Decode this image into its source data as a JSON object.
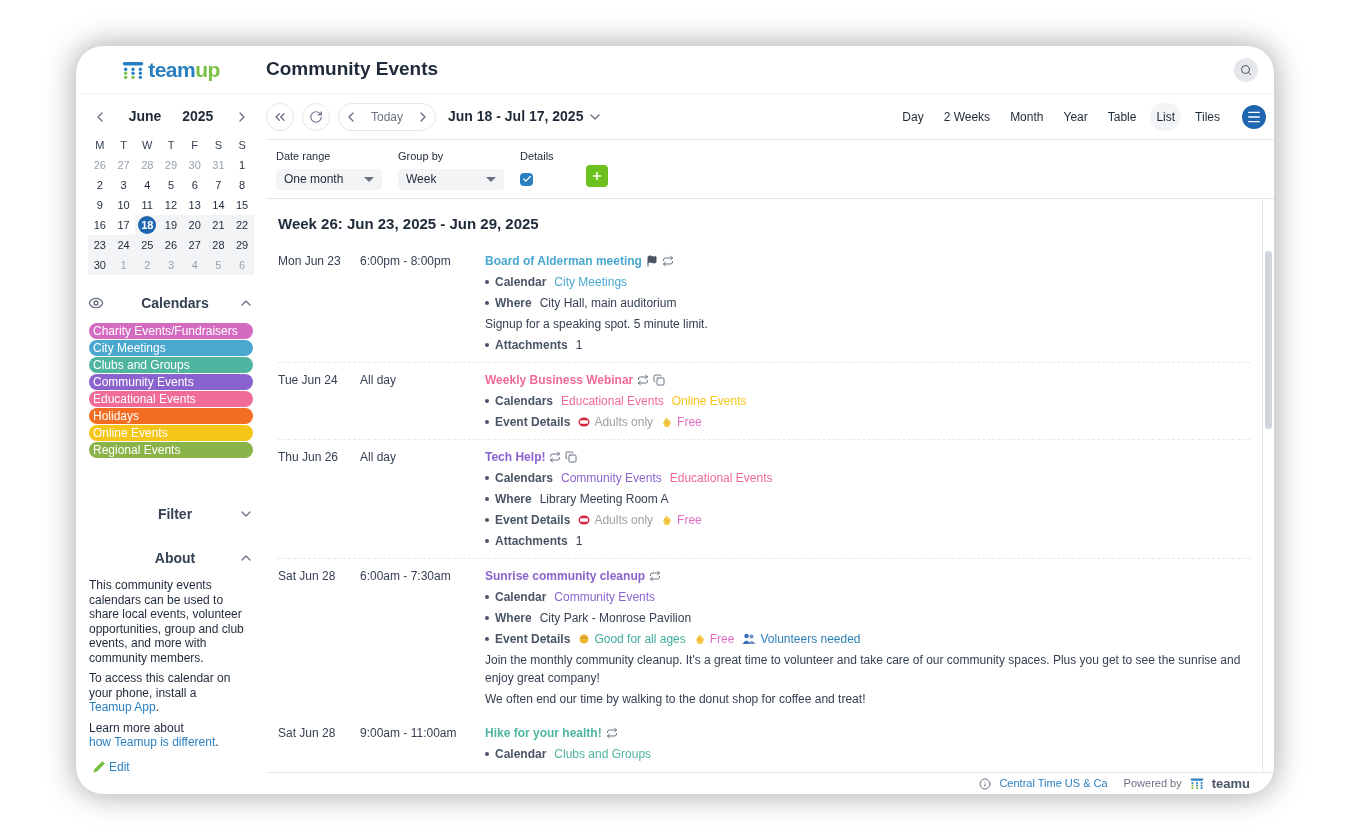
{
  "logo": {
    "part_1": "team",
    "part_2": "up"
  },
  "title": "Community Events",
  "mini_calendar": {
    "month": "June",
    "year": "2025",
    "weekdays": [
      "M",
      "T",
      "W",
      "T",
      "F",
      "S",
      "S"
    ],
    "weeks": [
      [
        {
          "d": "26",
          "muted": true,
          "in_range": false,
          "selected": false
        },
        {
          "d": "27",
          "muted": true,
          "in_range": false,
          "selected": false
        },
        {
          "d": "28",
          "muted": true,
          "in_range": false,
          "selected": false
        },
        {
          "d": "29",
          "muted": true,
          "in_range": false,
          "selected": false
        },
        {
          "d": "30",
          "muted": true,
          "in_range": false,
          "selected": false
        },
        {
          "d": "31",
          "muted": true,
          "in_range": false,
          "selected": false
        },
        {
          "d": "1",
          "muted": false,
          "in_range": false,
          "selected": false
        }
      ],
      [
        {
          "d": "2",
          "muted": false,
          "in_range": false,
          "selected": false
        },
        {
          "d": "3",
          "muted": false,
          "in_range": false,
          "selected": false
        },
        {
          "d": "4",
          "muted": false,
          "in_range": false,
          "selected": false
        },
        {
          "d": "5",
          "muted": false,
          "in_range": false,
          "selected": false
        },
        {
          "d": "6",
          "muted": false,
          "in_range": false,
          "selected": false
        },
        {
          "d": "7",
          "muted": false,
          "in_range": false,
          "selected": false
        },
        {
          "d": "8",
          "muted": false,
          "in_range": false,
          "selected": false
        }
      ],
      [
        {
          "d": "9",
          "muted": false,
          "in_range": false,
          "selected": false
        },
        {
          "d": "10",
          "muted": false,
          "in_range": false,
          "selected": false
        },
        {
          "d": "11",
          "muted": false,
          "in_range": false,
          "selected": false
        },
        {
          "d": "12",
          "muted": false,
          "in_range": false,
          "selected": false
        },
        {
          "d": "13",
          "muted": false,
          "in_range": false,
          "selected": false
        },
        {
          "d": "14",
          "muted": false,
          "in_range": false,
          "selected": false
        },
        {
          "d": "15",
          "muted": false,
          "in_range": false,
          "selected": false
        }
      ],
      [
        {
          "d": "16",
          "muted": false,
          "in_range": false,
          "selected": false
        },
        {
          "d": "17",
          "muted": false,
          "in_range": false,
          "selected": false
        },
        {
          "d": "18",
          "muted": false,
          "in_range": true,
          "selected": true
        },
        {
          "d": "19",
          "muted": false,
          "in_range": true,
          "selected": false
        },
        {
          "d": "20",
          "muted": false,
          "in_range": true,
          "selected": false
        },
        {
          "d": "21",
          "muted": false,
          "in_range": true,
          "selected": false
        },
        {
          "d": "22",
          "muted": false,
          "in_range": true,
          "selected": false
        }
      ],
      [
        {
          "d": "23",
          "muted": false,
          "in_range": true,
          "selected": false
        },
        {
          "d": "24",
          "muted": false,
          "in_range": true,
          "selected": false
        },
        {
          "d": "25",
          "muted": false,
          "in_range": true,
          "selected": false
        },
        {
          "d": "26",
          "muted": false,
          "in_range": true,
          "selected": false
        },
        {
          "d": "27",
          "muted": false,
          "in_range": true,
          "selected": false
        },
        {
          "d": "28",
          "muted": false,
          "in_range": true,
          "selected": false
        },
        {
          "d": "29",
          "muted": false,
          "in_range": true,
          "selected": false
        }
      ],
      [
        {
          "d": "30",
          "muted": false,
          "in_range": true,
          "selected": false
        },
        {
          "d": "1",
          "muted": true,
          "in_range": true,
          "selected": false
        },
        {
          "d": "2",
          "muted": true,
          "in_range": true,
          "selected": false
        },
        {
          "d": "3",
          "muted": true,
          "in_range": true,
          "selected": false
        },
        {
          "d": "4",
          "muted": true,
          "in_range": true,
          "selected": false
        },
        {
          "d": "5",
          "muted": true,
          "in_range": true,
          "selected": false
        },
        {
          "d": "6",
          "muted": true,
          "in_range": true,
          "selected": false
        }
      ]
    ]
  },
  "calendars": {
    "heading": "Calendars",
    "expanded": true,
    "items": [
      {
        "label": "Charity Events/Fundraisers",
        "color": "#d46bc1"
      },
      {
        "label": "City Meetings",
        "color": "#4aa8d0"
      },
      {
        "label": "Clubs and Groups",
        "color": "#4fb5a0"
      },
      {
        "label": "Community Events",
        "color": "#8b63cf"
      },
      {
        "label": "Educational Events",
        "color": "#f06a9a"
      },
      {
        "label": "Holidays",
        "color": "#f26d22"
      },
      {
        "label": "Online Events",
        "color": "#f5c518"
      },
      {
        "label": "Regional Events",
        "color": "#8ab34a"
      }
    ]
  },
  "filter": {
    "heading": "Filter",
    "expanded": false
  },
  "about": {
    "heading": "About",
    "expanded": true,
    "paragraph_1": "This community events calendars can be used to share local events, volunteer opportunities, group and club events, and more with community members.",
    "paragraph_2_text": "To access this calendar on your phone, install a",
    "paragraph_2_link": "Teamup App",
    "paragraph_2_end": ".",
    "paragraph_3_text": "Learn more about",
    "paragraph_3_link": "how Teamup is different",
    "paragraph_3_end": ".",
    "edit": "Edit"
  },
  "toolbar": {
    "today": "Today",
    "range": "Jun 18 - Jul 17, 2025",
    "views": [
      {
        "label": "Day",
        "selected": false
      },
      {
        "label": "2 Weeks",
        "selected": false
      },
      {
        "label": "Month",
        "selected": false
      },
      {
        "label": "Year",
        "selected": false
      },
      {
        "label": "Table",
        "selected": false
      },
      {
        "label": "List",
        "selected": true
      },
      {
        "label": "Tiles",
        "selected": false
      }
    ]
  },
  "options": {
    "date_range": {
      "label": "Date range",
      "value": "One month"
    },
    "group_by": {
      "label": "Group by",
      "value": "Week"
    },
    "details": {
      "label": "Details",
      "checked": true
    }
  },
  "week_heading": "Week 26: Jun 23, 2025 - Jun 29, 2025",
  "events": [
    {
      "date": "Mon Jun 23",
      "time": "6:00pm - 8:00pm",
      "title": "Board of Alderman meeting",
      "color": "#4aa8d0",
      "flagged": true,
      "repeats": true,
      "multi_calendar": false,
      "details": [
        {
          "kind": "calendars",
          "label": "Calendar",
          "values": [
            {
              "text": "City Meetings",
              "color": "#4aa8d0"
            }
          ]
        },
        {
          "kind": "field",
          "label": "Where",
          "value": "City Hall, main auditorium"
        },
        {
          "kind": "note",
          "text": "Signup for a speaking spot. 5 minute limit."
        },
        {
          "kind": "field",
          "label": "Attachments",
          "value": "1"
        }
      ]
    },
    {
      "date": "Tue Jun 24",
      "time": "All day",
      "title": "Weekly Business Webinar",
      "color": "#f06a9a",
      "flagged": false,
      "repeats": true,
      "multi_calendar": true,
      "details": [
        {
          "kind": "calendars",
          "label": "Calendars",
          "values": [
            {
              "text": "Educational Events",
              "color": "#f06a9a"
            },
            {
              "text": "Online Events",
              "color": "#f5c518"
            }
          ]
        },
        {
          "kind": "tags",
          "label": "Event Details",
          "tags": [
            {
              "kind": "adults",
              "text": "Adults only",
              "color": "#a0a0a0"
            },
            {
              "kind": "free",
              "text": "Free",
              "color": "#e26cc4"
            }
          ]
        }
      ]
    },
    {
      "date": "Thu Jun 26",
      "time": "All day",
      "title": "Tech Help!",
      "color": "#8b63cf",
      "flagged": false,
      "repeats": true,
      "multi_calendar": true,
      "details": [
        {
          "kind": "calendars",
          "label": "Calendars",
          "values": [
            {
              "text": "Community Events",
              "color": "#8b63cf"
            },
            {
              "text": "Educational Events",
              "color": "#f06a9a"
            }
          ]
        },
        {
          "kind": "field",
          "label": "Where",
          "value": "Library Meeting Room A"
        },
        {
          "kind": "tags",
          "label": "Event Details",
          "tags": [
            {
              "kind": "adults",
              "text": "Adults only",
              "color": "#a0a0a0"
            },
            {
              "kind": "free",
              "text": "Free",
              "color": "#e26cc4"
            }
          ]
        },
        {
          "kind": "field",
          "label": "Attachments",
          "value": "1"
        }
      ]
    },
    {
      "date": "Sat Jun 28",
      "time": "6:00am - 7:30am",
      "title": "Sunrise community cleanup",
      "color": "#8b63cf",
      "flagged": false,
      "repeats": true,
      "multi_calendar": false,
      "details": [
        {
          "kind": "calendars",
          "label": "Calendar",
          "values": [
            {
              "text": "Community Events",
              "color": "#8b63cf"
            }
          ]
        },
        {
          "kind": "field",
          "label": "Where",
          "value": "City Park - Monrose Pavilion"
        },
        {
          "kind": "tags",
          "label": "Event Details",
          "tags": [
            {
              "kind": "ages",
              "text": "Good for all ages",
              "color": "#3fae9a"
            },
            {
              "kind": "free",
              "text": "Free",
              "color": "#e26cc4"
            },
            {
              "kind": "volunteers",
              "text": "Volunteers needed",
              "color": "#2f7fb8"
            }
          ]
        },
        {
          "kind": "note",
          "text": "Join the monthly community cleanup. It's a great time to volunteer and take care of our community spaces. Plus you get to see the sunrise and enjoy great company!"
        },
        {
          "kind": "note",
          "text": "We often end our time by walking to the donut shop for coffee and treat!"
        }
      ]
    },
    {
      "date": "Sat Jun 28",
      "time": "9:00am - 11:00am",
      "title": "Hike for your health!",
      "color": "#4fb5a0",
      "flagged": false,
      "repeats": true,
      "multi_calendar": false,
      "details": [
        {
          "kind": "calendars",
          "label": "Calendar",
          "values": [
            {
              "text": "Clubs and Groups",
              "color": "#4fb5a0"
            }
          ]
        }
      ]
    }
  ],
  "footer": {
    "timezone": "Central Time US & Ca",
    "powered_by": "Powered by",
    "brand": "teamu"
  }
}
